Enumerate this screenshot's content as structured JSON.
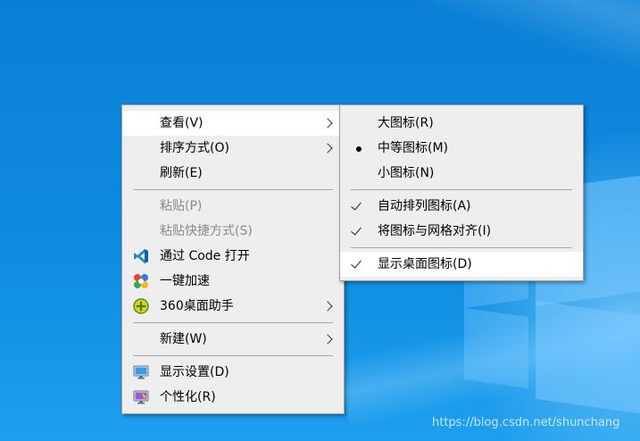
{
  "main_menu": {
    "items": [
      {
        "label": "查看(V)",
        "has_submenu": true,
        "highlighted": true
      },
      {
        "label": "排序方式(O)",
        "has_submenu": true
      },
      {
        "label": "刷新(E)"
      },
      {
        "label": "粘贴(P)",
        "disabled": true
      },
      {
        "label": "粘贴快捷方式(S)",
        "disabled": true
      },
      {
        "label": "通过 Code 打开",
        "icon": "vscode-icon"
      },
      {
        "label": "一键加速",
        "icon": "speedup-icon"
      },
      {
        "label": "360桌面助手",
        "icon": "360-assistant-icon",
        "has_submenu": true
      },
      {
        "label": "新建(W)",
        "has_submenu": true
      },
      {
        "label": "显示设置(D)",
        "icon": "display-settings-icon"
      },
      {
        "label": "个性化(R)",
        "icon": "personalize-icon"
      }
    ]
  },
  "view_submenu": {
    "items": [
      {
        "label": "大图标(R)"
      },
      {
        "label": "中等图标(M)",
        "selected": true
      },
      {
        "label": "小图标(N)"
      },
      {
        "label": "自动排列图标(A)",
        "checked": true
      },
      {
        "label": "将图标与网格对齐(I)",
        "checked": true
      },
      {
        "label": "显示桌面图标(D)",
        "checked": true,
        "highlighted": true
      }
    ]
  },
  "watermark": "https://blog.csdn.net/shunchang",
  "colors": {
    "desktop": "#0f8be0",
    "menu_bg": "#eeeeee",
    "highlight": "#ffffff",
    "disabled_text": "#8a8a8a"
  }
}
